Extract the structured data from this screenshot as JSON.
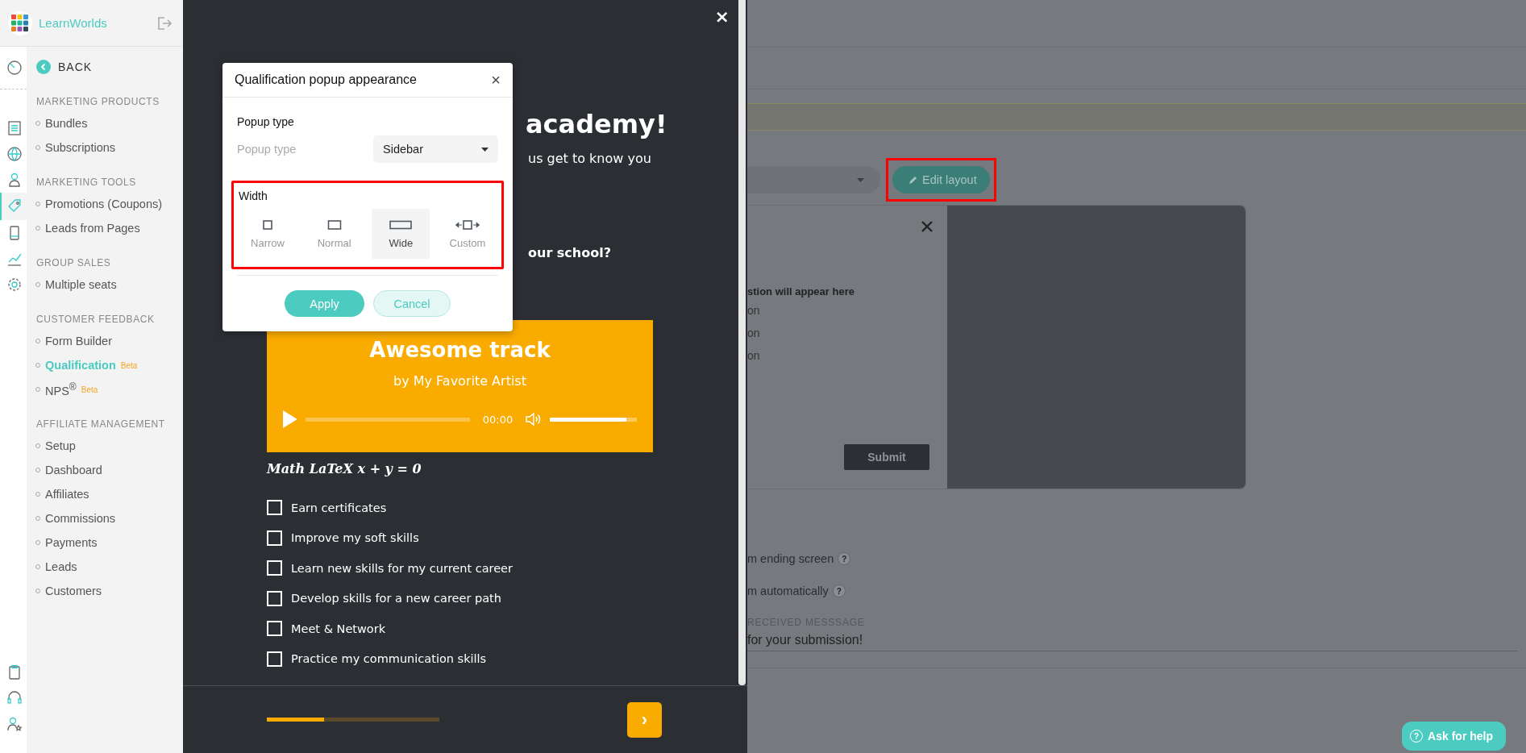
{
  "brand": {
    "name": "LearnWorlds"
  },
  "rail_icons": [
    {
      "kind": "gauge",
      "selected": false
    },
    {
      "kind": "pages",
      "selected": false
    },
    {
      "kind": "globe",
      "selected": false
    },
    {
      "kind": "user",
      "selected": false
    },
    {
      "kind": "tag",
      "selected": true
    },
    {
      "kind": "mobile",
      "selected": false
    },
    {
      "kind": "chart",
      "selected": false
    },
    {
      "kind": "gear",
      "selected": false
    }
  ],
  "rail_bottom_icons": [
    {
      "kind": "clipboard"
    },
    {
      "kind": "headset"
    },
    {
      "kind": "user-star"
    }
  ],
  "back": {
    "label": "BACK"
  },
  "nav_sections": [
    {
      "title": "MARKETING PRODUCTS",
      "items": [
        {
          "label": "Bundles",
          "selected": false
        },
        {
          "label": "Subscriptions",
          "selected": false
        }
      ]
    },
    {
      "title": "MARKETING TOOLS",
      "items": [
        {
          "label": "Promotions (Coupons)",
          "selected": false
        },
        {
          "label": "Leads from Pages",
          "selected": false
        }
      ]
    },
    {
      "title": "GROUP SALES",
      "items": [
        {
          "label": "Multiple seats",
          "selected": false
        }
      ]
    },
    {
      "title": "CUSTOMER FEEDBACK",
      "items": [
        {
          "label": "Form Builder",
          "selected": false
        },
        {
          "label": "Qualification",
          "selected": true,
          "badge": "Beta"
        },
        {
          "label": "NPS$^{®}$",
          "selected": false,
          "badge": "Beta"
        }
      ]
    },
    {
      "title": "AFFILIATE MANAGEMENT",
      "items": [
        {
          "label": "Setup",
          "selected": false
        },
        {
          "label": "Dashboard",
          "selected": false
        },
        {
          "label": "Affiliates",
          "selected": false
        },
        {
          "label": "Commissions",
          "selected": false
        },
        {
          "label": "Payments",
          "selected": false
        },
        {
          "label": "Leads",
          "selected": false
        },
        {
          "label": "Customers",
          "selected": false
        }
      ]
    }
  ],
  "survey": {
    "close": "×",
    "heading": "academy!",
    "subtitle": "us get to know you",
    "question": "our school?",
    "audio": {
      "title": "Awesome track",
      "artist": "by My Favorite Artist",
      "time": "00:00",
      "volume": {
        "level": 0.88
      }
    },
    "math": "Math LaTeX x + y = 0",
    "options": [
      {
        "label": "Earn certificates",
        "checked": false
      },
      {
        "label": "Improve my soft skills",
        "checked": false
      },
      {
        "label": "Learn new skills for my current career",
        "checked": false
      },
      {
        "label": "Develop skills for a new career path",
        "checked": false
      },
      {
        "label": "Meet & Network",
        "checked": false
      },
      {
        "label": "Practice my communication skills",
        "checked": false
      }
    ],
    "progress": {
      "level": 0.33
    },
    "next": "›"
  },
  "popup": {
    "title": "Qualification popup appearance",
    "close": "×",
    "type_section": "Popup type",
    "type_label": "Popup type",
    "type_value": "Sidebar",
    "width_section": "Width",
    "widths": [
      {
        "label": "Narrow",
        "kind": "narrow",
        "selected": false
      },
      {
        "label": "Normal",
        "kind": "normal",
        "selected": false
      },
      {
        "label": "Wide",
        "kind": "wide",
        "selected": true
      },
      {
        "label": "Custom",
        "kind": "custom",
        "selected": false
      }
    ],
    "apply": "Apply",
    "cancel": "Cancel"
  },
  "editor": {
    "edit_layout": "Edit layout",
    "preview": {
      "question": "stion will appear here",
      "options": [
        "on",
        "on",
        "on"
      ],
      "submit": "Submit"
    },
    "settings": [
      {
        "label": "m ending screen",
        "help": "?"
      },
      {
        "label": "m automatically",
        "help": "?"
      }
    ],
    "message_label": "RECEIVED MESSSAGE",
    "message_value": "for your submission!"
  },
  "help_button": {
    "icon": "?",
    "label": "Ask for help"
  }
}
